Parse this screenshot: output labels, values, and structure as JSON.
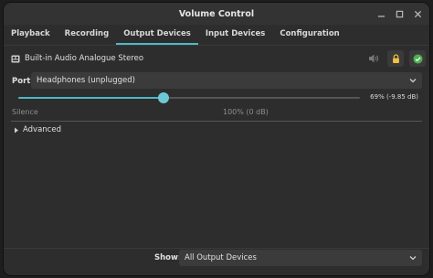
{
  "window": {
    "title": "Volume Control"
  },
  "tabs": [
    {
      "label": "Playback"
    },
    {
      "label": "Recording"
    },
    {
      "label": "Output Devices",
      "active": true
    },
    {
      "label": "Input Devices"
    },
    {
      "label": "Configuration"
    }
  ],
  "device": {
    "name": "Built-in Audio Analogue Stereo",
    "icon": "sound-card-icon"
  },
  "port": {
    "label": "Port:",
    "selected": "Headphones (unplugged)"
  },
  "volume": {
    "readout": "69% (-9.85 dB)",
    "percent": 69,
    "silence_label": "Silence",
    "hundred_label": "100% (0 dB)"
  },
  "advanced": {
    "label": "Advanced"
  },
  "footer": {
    "show_label": "Show:",
    "show_selected": "All Output Devices"
  },
  "colors": {
    "accent": "#4fb8c7",
    "lock": "#f0c040",
    "default_check": "#4caf50"
  }
}
